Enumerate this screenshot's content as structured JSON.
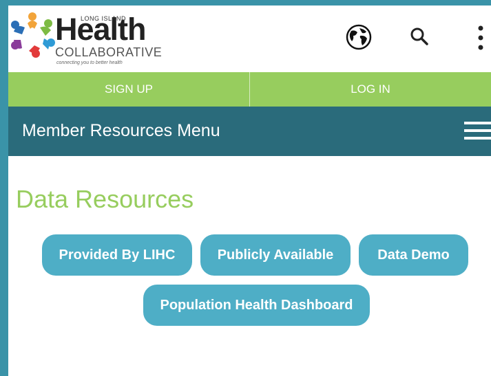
{
  "header": {
    "logo_top": "LONG ISLAND",
    "logo_main": "Health",
    "logo_sub": "COLLABORATIVE",
    "logo_tagline": "connecting you to better health",
    "icons": [
      "globe-icon",
      "search-icon",
      "more-vertical-icon"
    ]
  },
  "auth": {
    "signup_label": "SIGN UP",
    "login_label": "LOG IN"
  },
  "member_menu": {
    "title": "Member Resources Menu",
    "menu_icon": "hamburger-menu-icon"
  },
  "main": {
    "section_title": "Data Resources",
    "buttons": [
      {
        "label": "Provided By LIHC"
      },
      {
        "label": "Publicly Available"
      },
      {
        "label": "Data Demo"
      },
      {
        "label": "Population Health Dashboard"
      }
    ]
  },
  "colors": {
    "frame": "#3a93a8",
    "green": "#97cd5e",
    "member_bar": "#2a6b7b",
    "button": "#4eaec6"
  }
}
